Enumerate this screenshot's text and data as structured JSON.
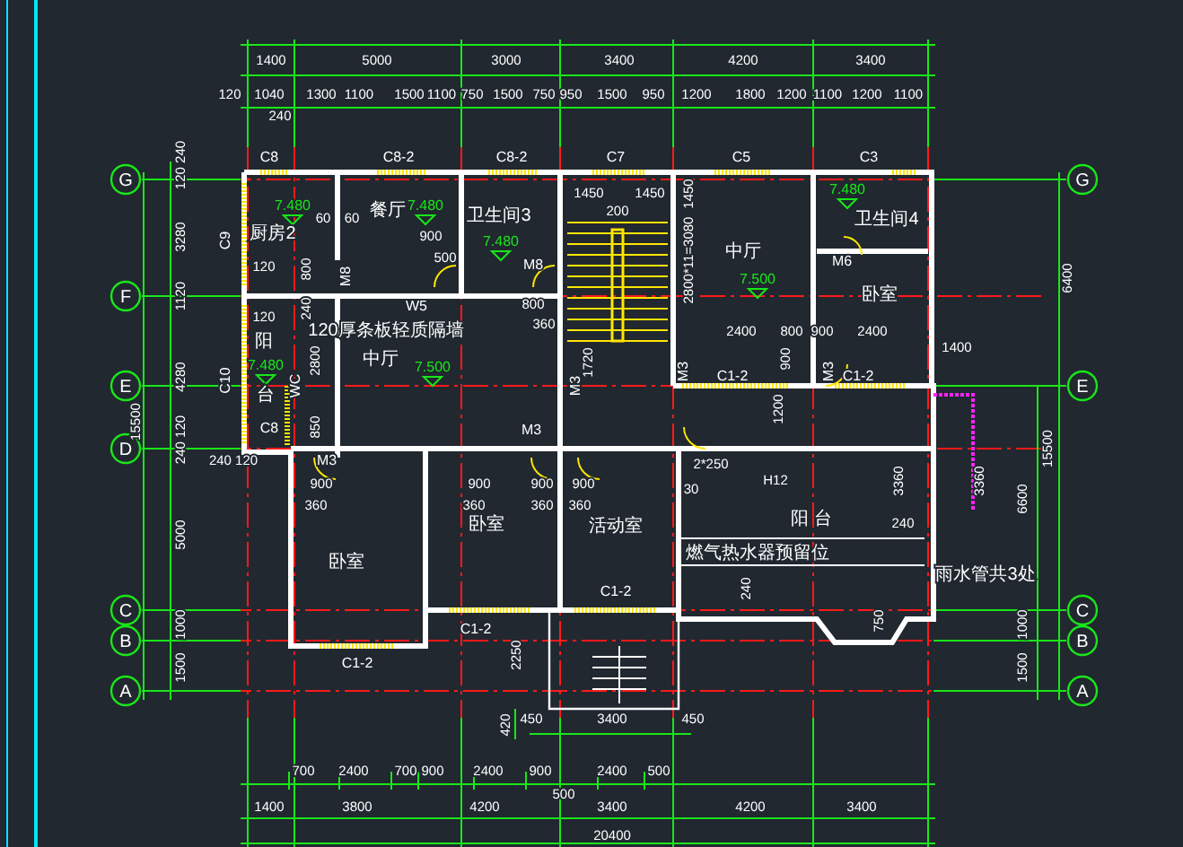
{
  "plan": {
    "axes_left": [
      {
        "label": "G"
      },
      {
        "label": "F"
      },
      {
        "label": "E"
      },
      {
        "label": "D"
      },
      {
        "label": "C"
      },
      {
        "label": "B"
      },
      {
        "label": "A"
      }
    ],
    "axes_right": [
      {
        "label": "G"
      },
      {
        "label": "E"
      },
      {
        "label": "C"
      },
      {
        "label": "B"
      },
      {
        "label": "A"
      }
    ],
    "labels": [
      {
        "text": "1400",
        "kind": "dim"
      },
      {
        "text": "5000",
        "kind": "dim"
      },
      {
        "text": "3000",
        "kind": "dim"
      },
      {
        "text": "3400",
        "kind": "dim"
      },
      {
        "text": "4200",
        "kind": "dim"
      },
      {
        "text": "3400",
        "kind": "dim"
      },
      {
        "text": "120",
        "kind": "dim"
      },
      {
        "text": "1040",
        "kind": "dim"
      },
      {
        "text": "1300",
        "kind": "dim"
      },
      {
        "text": "1100",
        "kind": "dim"
      },
      {
        "text": "1500",
        "kind": "dim"
      },
      {
        "text": "1100",
        "kind": "dim"
      },
      {
        "text": "750",
        "kind": "dim"
      },
      {
        "text": "1500",
        "kind": "dim"
      },
      {
        "text": "750",
        "kind": "dim"
      },
      {
        "text": "950",
        "kind": "dim"
      },
      {
        "text": "1500",
        "kind": "dim"
      },
      {
        "text": "950",
        "kind": "dim"
      },
      {
        "text": "1200",
        "kind": "dim"
      },
      {
        "text": "1800",
        "kind": "dim"
      },
      {
        "text": "1200",
        "kind": "dim"
      },
      {
        "text": "1100",
        "kind": "dim"
      },
      {
        "text": "1200",
        "kind": "dim"
      },
      {
        "text": "1100",
        "kind": "dim"
      },
      {
        "text": "240",
        "kind": "dim"
      },
      {
        "text": "120 240",
        "kind": "dim"
      },
      {
        "text": "3280",
        "kind": "dim"
      },
      {
        "text": "1120",
        "kind": "dim"
      },
      {
        "text": "4280",
        "kind": "dim"
      },
      {
        "text": "240 120",
        "kind": "dim"
      },
      {
        "text": "5000",
        "kind": "dim"
      },
      {
        "text": "1000",
        "kind": "dim"
      },
      {
        "text": "1500",
        "kind": "dim"
      },
      {
        "text": "15500",
        "kind": "dim"
      },
      {
        "text": "6400",
        "kind": "dim"
      },
      {
        "text": "15500",
        "kind": "dim"
      },
      {
        "text": "6600",
        "kind": "dim"
      },
      {
        "text": "1000",
        "kind": "dim"
      },
      {
        "text": "1500",
        "kind": "dim"
      },
      {
        "text": "3360",
        "kind": "dim"
      },
      {
        "text": "3360",
        "kind": "dim"
      },
      {
        "text": "1400",
        "kind": "dim"
      },
      {
        "text": "420",
        "kind": "dim"
      },
      {
        "text": "450",
        "kind": "dim"
      },
      {
        "text": "3400",
        "kind": "dim"
      },
      {
        "text": "450",
        "kind": "dim"
      },
      {
        "text": "700",
        "kind": "dim"
      },
      {
        "text": "2400",
        "kind": "dim"
      },
      {
        "text": "700",
        "kind": "dim"
      },
      {
        "text": "900",
        "kind": "dim"
      },
      {
        "text": "2400",
        "kind": "dim"
      },
      {
        "text": "900",
        "kind": "dim"
      },
      {
        "text": "2400",
        "kind": "dim"
      },
      {
        "text": "500",
        "kind": "dim"
      },
      {
        "text": "500",
        "kind": "dim"
      },
      {
        "text": "1400",
        "kind": "dim"
      },
      {
        "text": "3800",
        "kind": "dim"
      },
      {
        "text": "4200",
        "kind": "dim"
      },
      {
        "text": "3400",
        "kind": "dim"
      },
      {
        "text": "4200",
        "kind": "dim"
      },
      {
        "text": "3400",
        "kind": "dim"
      },
      {
        "text": "20400",
        "kind": "dim"
      },
      {
        "text": "C8",
        "kind": "tag"
      },
      {
        "text": "C8-2",
        "kind": "tag"
      },
      {
        "text": "C8-2",
        "kind": "tag"
      },
      {
        "text": "C7",
        "kind": "tag"
      },
      {
        "text": "C5",
        "kind": "tag"
      },
      {
        "text": "C3",
        "kind": "tag"
      },
      {
        "text": "C9",
        "kind": "tag"
      },
      {
        "text": "C10",
        "kind": "tag"
      },
      {
        "text": "C8",
        "kind": "tag"
      },
      {
        "text": "C1-2",
        "kind": "tag"
      },
      {
        "text": "C1-2",
        "kind": "tag"
      },
      {
        "text": "C1-2",
        "kind": "tag"
      },
      {
        "text": "C1-2",
        "kind": "tag"
      },
      {
        "text": "C1-2",
        "kind": "tag"
      },
      {
        "text": "M3",
        "kind": "tag"
      },
      {
        "text": "M8",
        "kind": "tag"
      },
      {
        "text": "M8",
        "kind": "tag"
      },
      {
        "text": "W5",
        "kind": "tag"
      },
      {
        "text": "M6",
        "kind": "tag"
      },
      {
        "text": "WC",
        "kind": "tag"
      },
      {
        "text": "M3",
        "kind": "tag"
      },
      {
        "text": "M3",
        "kind": "tag"
      },
      {
        "text": "M3",
        "kind": "tag"
      },
      {
        "text": "M3",
        "kind": "tag"
      },
      {
        "text": "60",
        "kind": "dim"
      },
      {
        "text": "60",
        "kind": "dim"
      },
      {
        "text": "900",
        "kind": "dim"
      },
      {
        "text": "500",
        "kind": "dim"
      },
      {
        "text": "800",
        "kind": "dim"
      },
      {
        "text": "360",
        "kind": "dim"
      },
      {
        "text": "800",
        "kind": "dim"
      },
      {
        "text": "240",
        "kind": "dim"
      },
      {
        "text": "120",
        "kind": "dim"
      },
      {
        "text": "120",
        "kind": "dim"
      },
      {
        "text": "2800",
        "kind": "dim"
      },
      {
        "text": "850",
        "kind": "dim"
      },
      {
        "text": "1450",
        "kind": "dim"
      },
      {
        "text": "1450",
        "kind": "dim"
      },
      {
        "text": "200",
        "kind": "dim"
      },
      {
        "text": "1720",
        "kind": "dim"
      },
      {
        "text": "2800*11=3080",
        "kind": "dim"
      },
      {
        "text": "1450",
        "kind": "dim"
      },
      {
        "text": "2400",
        "kind": "dim"
      },
      {
        "text": "800",
        "kind": "dim"
      },
      {
        "text": "900",
        "kind": "dim"
      },
      {
        "text": "2400",
        "kind": "dim"
      },
      {
        "text": "900",
        "kind": "dim"
      },
      {
        "text": "1200",
        "kind": "dim"
      },
      {
        "text": "240 120",
        "kind": "dim"
      },
      {
        "text": "900",
        "kind": "dim"
      },
      {
        "text": "360",
        "kind": "dim"
      },
      {
        "text": "900",
        "kind": "dim"
      },
      {
        "text": "360",
        "kind": "dim"
      },
      {
        "text": "900",
        "kind": "dim"
      },
      {
        "text": "360",
        "kind": "dim"
      },
      {
        "text": "900",
        "kind": "dim"
      },
      {
        "text": "360",
        "kind": "dim"
      },
      {
        "text": "2250",
        "kind": "dim"
      },
      {
        "text": "2*250",
        "kind": "dim"
      },
      {
        "text": "30",
        "kind": "dim"
      },
      {
        "text": "240",
        "kind": "dim"
      },
      {
        "text": "240",
        "kind": "dim"
      },
      {
        "text": "750",
        "kind": "dim"
      },
      {
        "text": "7.480",
        "kind": "elev"
      },
      {
        "text": "7.480",
        "kind": "elev"
      },
      {
        "text": "7.480",
        "kind": "elev"
      },
      {
        "text": "7.480",
        "kind": "elev"
      },
      {
        "text": "7.500",
        "kind": "elev"
      },
      {
        "text": "7.500",
        "kind": "elev"
      },
      {
        "text": "7.480",
        "kind": "elev"
      },
      {
        "text": "厨房2",
        "kind": "room"
      },
      {
        "text": "餐厅",
        "kind": "room"
      },
      {
        "text": "卫生间3",
        "kind": "room"
      },
      {
        "text": "阳",
        "kind": "room"
      },
      {
        "text": "台",
        "kind": "room"
      },
      {
        "text": "中厅",
        "kind": "room"
      },
      {
        "text": "中厅",
        "kind": "room"
      },
      {
        "text": "卫生间4",
        "kind": "room"
      },
      {
        "text": "卧室",
        "kind": "room"
      },
      {
        "text": "卧室",
        "kind": "room"
      },
      {
        "text": "卧室",
        "kind": "room"
      },
      {
        "text": "活动室",
        "kind": "room"
      },
      {
        "text": "阳 台",
        "kind": "room"
      },
      {
        "text": "H12",
        "kind": "dim"
      },
      {
        "text": "120厚条板轻质隔墙",
        "kind": "note"
      },
      {
        "text": "燃气热水器预留位",
        "kind": "note"
      },
      {
        "text": "雨水管共3处",
        "kind": "note"
      }
    ]
  }
}
